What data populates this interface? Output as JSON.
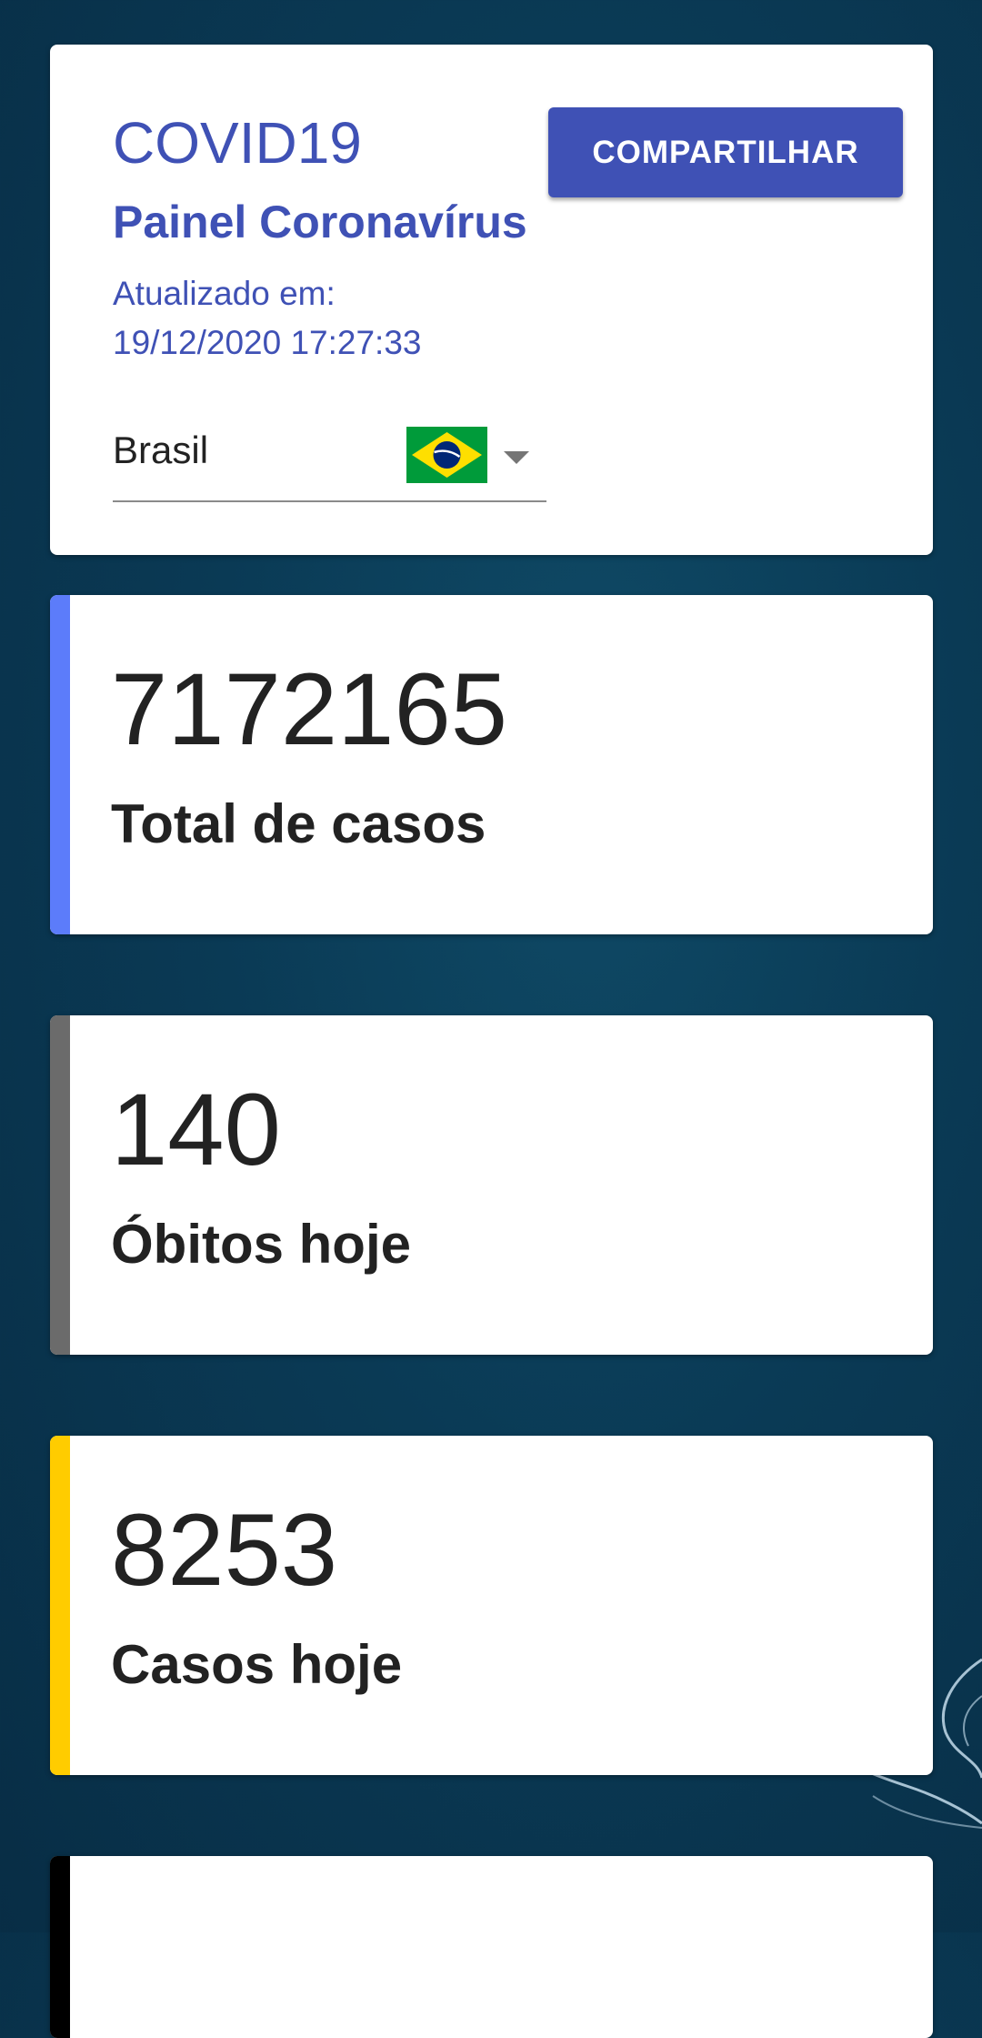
{
  "header": {
    "title": "COVID19",
    "subtitle": "Painel Coronavírus",
    "updated_label": "Atualizado em:",
    "updated_value": "19/12/2020 17:27:33",
    "share_label": "COMPARTILHAR",
    "country": "Brasil",
    "country_flag_icon": "brazil-flag-icon"
  },
  "stats": [
    {
      "value": "7172165",
      "label": "Total de casos",
      "accent": "#5c7cfa"
    },
    {
      "value": "140",
      "label": "Óbitos hoje",
      "accent": "#6b6b6b"
    },
    {
      "value": "8253",
      "label": "Casos hoje",
      "accent": "#ffcc00"
    },
    {
      "value": "",
      "label": "",
      "accent": "#000000"
    }
  ],
  "colors": {
    "primary": "#3f51b5",
    "background": "#0a3a55",
    "card": "#ffffff",
    "text": "#222222"
  }
}
